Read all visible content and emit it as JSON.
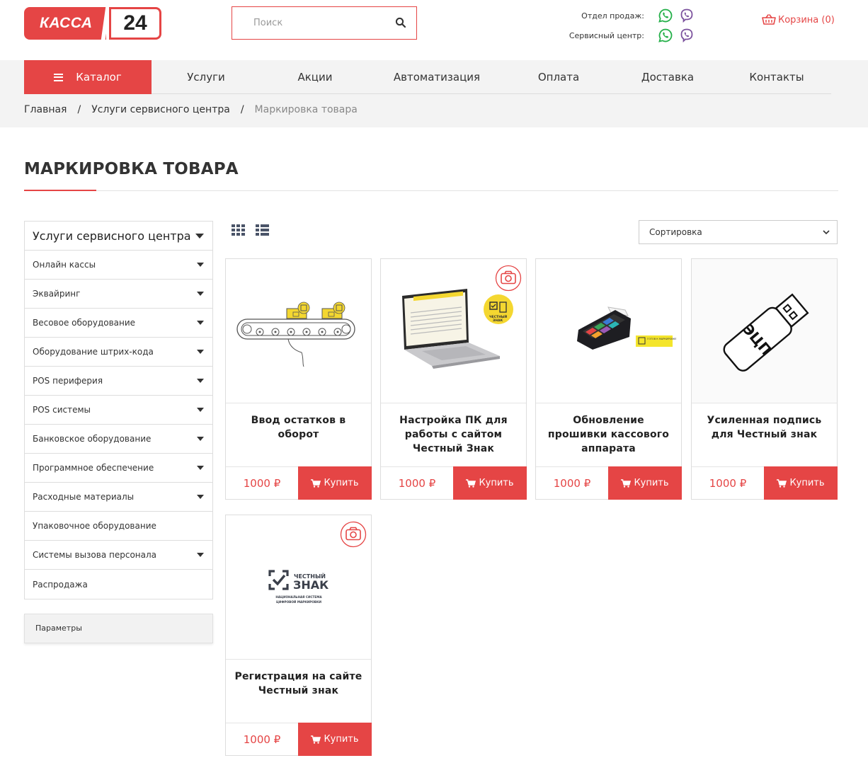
{
  "header": {
    "logo_left": "КАССА",
    "logo_right": "24",
    "search_placeholder": "Поиск",
    "contacts": [
      {
        "label": "Отдел продаж:"
      },
      {
        "label": "Сервисный центр:"
      }
    ],
    "cart_label": "Корзина (0)"
  },
  "nav": {
    "catalog_label": "Каталог",
    "items": [
      "Услуги",
      "Акции",
      "Автоматизация",
      "Оплата",
      "Доставка",
      "Контакты"
    ]
  },
  "breadcrumb": {
    "items": [
      "Главная",
      "Услуги сервисного центра"
    ],
    "separator": "/",
    "current": "Маркировка товара"
  },
  "page": {
    "title": "МАРКИРОВКА ТОВАРА"
  },
  "sidebar": {
    "heading": "Услуги сервисного центра",
    "items": [
      {
        "label": "Онлайн кассы",
        "has_sub": true
      },
      {
        "label": "Эквайринг",
        "has_sub": true
      },
      {
        "label": "Весовое оборудование",
        "has_sub": true
      },
      {
        "label": "Оборудование штрих-кода",
        "has_sub": true
      },
      {
        "label": "POS периферия",
        "has_sub": true
      },
      {
        "label": "POS системы",
        "has_sub": true
      },
      {
        "label": "Банковское оборудование",
        "has_sub": true
      },
      {
        "label": "Программное обеспечение",
        "has_sub": true
      },
      {
        "label": "Расходные материалы",
        "has_sub": true
      },
      {
        "label": "Упаковочное оборудование",
        "has_sub": false
      },
      {
        "label": "Системы вызова персонала",
        "has_sub": true
      },
      {
        "label": "Распродажа",
        "has_sub": false
      }
    ],
    "params_label": "Параметры"
  },
  "toolbar": {
    "sort_selected": "Сортировка"
  },
  "products": [
    {
      "name": "Ввод остатков в оборот",
      "price": "1000 ₽",
      "buy_label": "Купить"
    },
    {
      "name": "Настройка ПК для работы с сайтом Честный Знак",
      "price": "1000 ₽",
      "buy_label": "Купить"
    },
    {
      "name": "Обновление прошивки кассового аппарата",
      "price": "1000 ₽",
      "buy_label": "Купить"
    },
    {
      "name": "Усиленная подпись для Честный знак",
      "price": "1000 ₽",
      "buy_label": "Купить"
    },
    {
      "name": "Регистрация на сайте Честный знак",
      "price": "1000 ₽",
      "buy_label": "Купить"
    }
  ],
  "image_text": {
    "chestny_znak_badge_1": "ЧЕСТНЫЙ",
    "chestny_znak_badge_2": "ЗНАК",
    "ready_badge": "ГОТОВ К МАРКИРОВКЕ",
    "usb_label": "ЭЦП",
    "logo_small": "ЧЕСТНЫЙ",
    "logo_big": "ЗНАК",
    "logo_sub_1": "НАЦИОНАЛЬНАЯ СИСТЕМА",
    "logo_sub_2": "ЦИФРОВОЙ МАРКИРОВКИ"
  },
  "colors": {
    "accent": "#e54545",
    "whatsapp": "#25b04a",
    "viber": "#7b519d",
    "nav_bg": "#f3f3f3"
  }
}
